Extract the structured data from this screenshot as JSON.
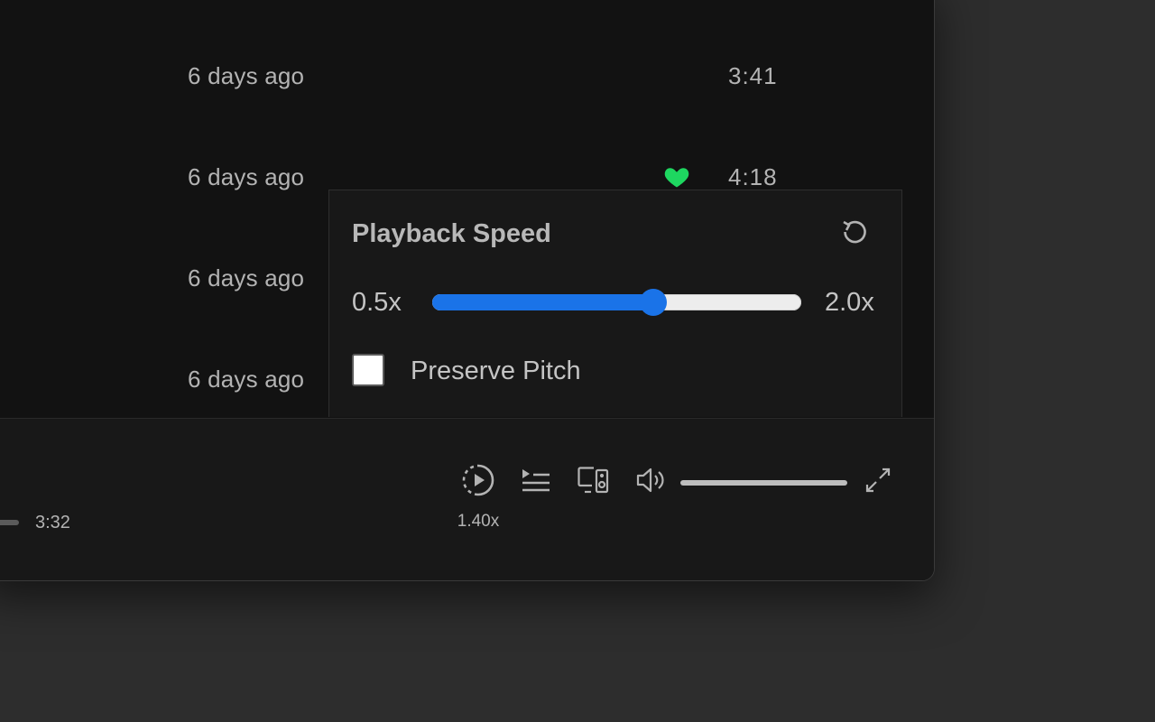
{
  "track_list": {
    "rows": [
      {
        "added": "6 days ago",
        "duration": "3:41",
        "liked": false
      },
      {
        "added": "6 days ago",
        "duration": "4:18",
        "liked": true
      },
      {
        "added": "6 days ago",
        "duration": "",
        "liked": false
      },
      {
        "added": "6 days ago",
        "duration": "",
        "liked": false
      }
    ]
  },
  "playback_popover": {
    "title": "Playback Speed",
    "reset_icon": "reset-icon",
    "min_label": "0.5x",
    "max_label": "2.0x",
    "speed_min": 0.5,
    "speed_max": 2.0,
    "speed_value": 1.4,
    "preserve_pitch_label": "Preserve Pitch",
    "preserve_pitch_checked": false
  },
  "player_bar": {
    "total_time": "3:32",
    "speed_badge": "1.40x",
    "volume_level": 1.0,
    "icons": [
      "playback-speed-icon",
      "queue-icon",
      "connect-device-icon",
      "volume-icon",
      "fullscreen-icon"
    ]
  },
  "colors": {
    "accent_blue": "#1a73e8",
    "liked_green": "#1ed760",
    "text_muted": "#b3b3b3"
  }
}
